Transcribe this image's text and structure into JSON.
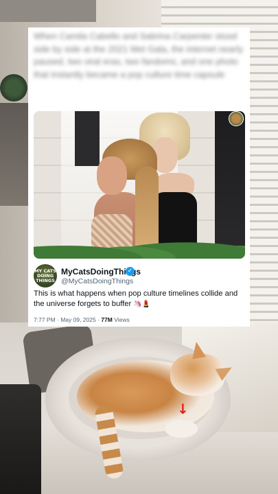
{
  "post": {
    "headline": "When Camila Cabello and Sabrina Carpenter stood side by side at the 2021 Met Gala, the internet nearly paused, two viral eras, two fandoms, and one photo that instantly became a pop culture time capsule",
    "avatar_text": "MY CATS DOING THINGS",
    "display_name": "MyCatsDoingThings",
    "verified_icon": "verified-badge-icon",
    "verified_color": "#1d9bf0",
    "handle": "@MyCatsDoingThings",
    "text": "This is what happens when pop culture timelines collide and the universe forgets to buffer",
    "text_emoji": "🦄💄",
    "time": "7:77 PM · May 09, 2025 · ",
    "views_count": "77M",
    "views_label": " Views"
  },
  "overlay": {
    "arrow_icon": "down-arrow-icon",
    "arrow_glyph": "↓",
    "arrow_color": "#e0201c"
  }
}
